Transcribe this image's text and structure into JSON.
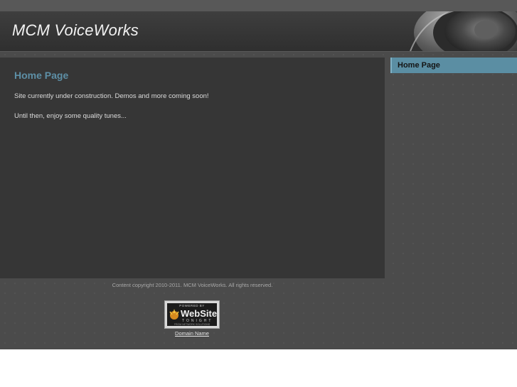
{
  "header": {
    "site_title": "MCM VoiceWorks"
  },
  "main": {
    "heading": "Home Page",
    "paragraphs": [
      "Site currently under construction. Demos and more coming soon!",
      "Until then, enjoy some quality tunes..."
    ]
  },
  "sidebar": {
    "items": [
      {
        "label": "Home Page"
      }
    ]
  },
  "footer": {
    "copyright": "Content copyright 2010-2011. MCM VoiceWorks. All rights reserved.",
    "badge": {
      "powered_by": "POWERED BY",
      "brand": "WebSite",
      "tagline": "TONIGHT",
      "from": "FROM NETWORK SOLUTIONS"
    },
    "domain_link": "Domain Name"
  },
  "colors": {
    "accent": "#5b8ea3",
    "heading": "#5d8fa6",
    "background": "#4b4b4b",
    "content_panel": "#363636"
  },
  "icons": [
    "speaker-graphic",
    "badge-logo-icon"
  ]
}
